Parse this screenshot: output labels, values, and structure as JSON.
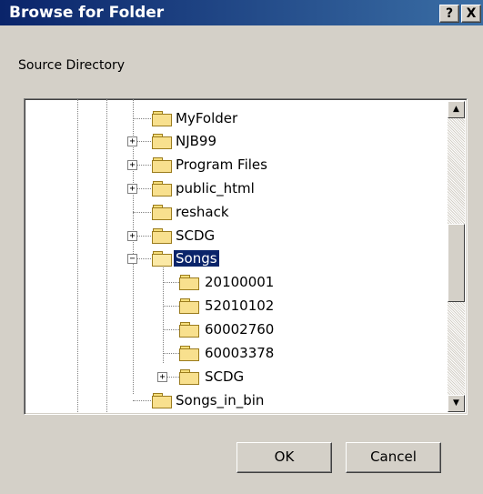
{
  "window": {
    "title": "Browse for Folder",
    "help_label": "?",
    "close_label": "X"
  },
  "label": "Source Directory",
  "tree": {
    "items": [
      {
        "label": "MyFolder",
        "expander": ""
      },
      {
        "label": "NJB99",
        "expander": "+"
      },
      {
        "label": "Program Files",
        "expander": "+"
      },
      {
        "label": "public_html",
        "expander": "+"
      },
      {
        "label": "reshack",
        "expander": ""
      },
      {
        "label": "SCDG",
        "expander": "+"
      },
      {
        "label": "Songs",
        "expander": "−",
        "selected": true,
        "open": true
      },
      {
        "label": "20100001",
        "expander": ""
      },
      {
        "label": "52010102",
        "expander": ""
      },
      {
        "label": "60002760",
        "expander": ""
      },
      {
        "label": "60003378",
        "expander": ""
      },
      {
        "label": "SCDG",
        "expander": "+"
      },
      {
        "label": "Songs_in_bin",
        "expander": ""
      }
    ]
  },
  "buttons": {
    "ok": "OK",
    "cancel": "Cancel"
  },
  "colors": {
    "titlebar_start": "#0a246a",
    "titlebar_end": "#3a6ea5",
    "selection": "#0a246a",
    "folder": "#f8e08e"
  },
  "icons": {
    "folder": "folder-icon",
    "open_folder": "folder-open-icon",
    "scroll_up": "arrow-up-icon",
    "scroll_down": "arrow-down-icon"
  }
}
